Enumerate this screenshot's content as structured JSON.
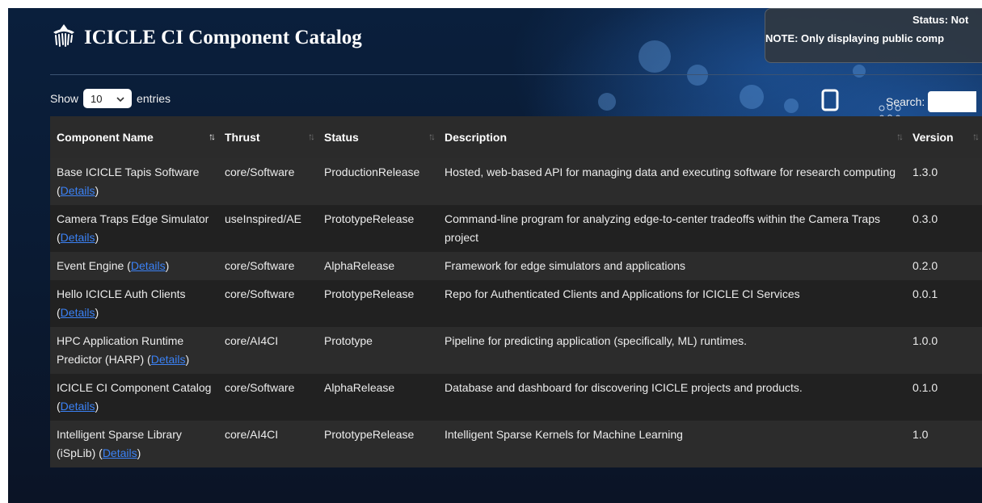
{
  "header": {
    "title": "ICICLE CI Component Catalog",
    "logo_icon": "icicle-logo-icon",
    "status_text": "Status: Not",
    "note_text": "NOTE: Only displaying public comp"
  },
  "controls": {
    "show_label": "Show",
    "entries_value": "10",
    "entries_label": "entries",
    "search_label": "Search:",
    "search_value": ""
  },
  "table": {
    "columns": [
      "Component Name",
      "Thrust",
      "Status",
      "Description",
      "Version"
    ],
    "sorted_column": "Component Name",
    "details_label": "Details",
    "rows": [
      {
        "name": "Base ICICLE Tapis Software",
        "thrust": "core/Software",
        "status": "ProductionRelease",
        "description": "Hosted, web-based API for managing data and executing software for research computing",
        "version": "1.3.0"
      },
      {
        "name": "Camera Traps Edge Simulator",
        "thrust": "useInspired/AE",
        "status": "PrototypeRelease",
        "description": "Command-line program for analyzing edge-to-center tradeoffs within the Camera Traps project",
        "version": "0.3.0"
      },
      {
        "name": "Event Engine",
        "thrust": "core/Software",
        "status": "AlphaRelease",
        "description": "Framework for edge simulators and applications",
        "version": "0.2.0"
      },
      {
        "name": "Hello ICICLE Auth Clients",
        "thrust": "core/Software",
        "status": "PrototypeRelease",
        "description": "Repo for Authenticated Clients and Applications for ICICLE CI Services",
        "version": "0.0.1"
      },
      {
        "name": "HPC Application Runtime Predictor (HARP)",
        "thrust": "core/AI4CI",
        "status": "Prototype",
        "description": "Pipeline for predicting application (specifically, ML) runtimes.",
        "version": "1.0.0"
      },
      {
        "name": "ICICLE CI Component Catalog",
        "thrust": "core/Software",
        "status": "AlphaRelease",
        "description": "Database and dashboard for discovering ICICLE projects and products.",
        "version": "0.1.0"
      },
      {
        "name": "Intelligent Sparse Library (iSpLib)",
        "thrust": "core/AI4CI",
        "status": "PrototypeRelease",
        "description": "Intelligent Sparse Kernels for Machine Learning",
        "version": "1.0"
      }
    ]
  }
}
